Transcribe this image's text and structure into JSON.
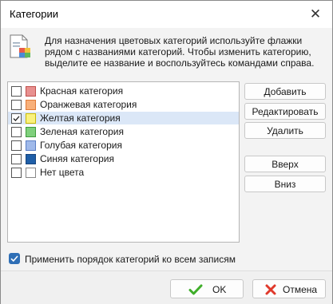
{
  "window": {
    "title": "Категории"
  },
  "description": "Для назначения цветовых категорий используйте флажки рядом с названиями категорий. Чтобы изменить категорию, выделите ее название и воспользуйтесь командами справа.",
  "categories": [
    {
      "label": "Красная категория",
      "checked": false,
      "color": "#e8908f",
      "border": "#c0504d"
    },
    {
      "label": "Оранжевая категория",
      "checked": false,
      "color": "#f8b07a",
      "border": "#e07b39"
    },
    {
      "label": "Желтая категория",
      "checked": true,
      "color": "#f9f17d",
      "border": "#c9b800",
      "selected": true
    },
    {
      "label": "Зеленая категория",
      "checked": false,
      "color": "#7fd07c",
      "border": "#3f9a3c"
    },
    {
      "label": "Голубая категория",
      "checked": false,
      "color": "#9fb9ea",
      "border": "#5b7fc4"
    },
    {
      "label": "Синяя категория",
      "checked": false,
      "color": "#1f5fa8",
      "border": "#18457c"
    },
    {
      "label": "Нет цвета",
      "checked": false,
      "color": "#ffffff",
      "border": "#888888"
    }
  ],
  "actions": {
    "add": "Добавить",
    "edit": "Редактировать",
    "delete": "Удалить",
    "up": "Вверх",
    "down": "Вниз"
  },
  "apply_order": {
    "label": "Применить порядок категорий ко всем записям",
    "checked": true
  },
  "footer": {
    "ok": "OK",
    "cancel": "Отмена"
  }
}
